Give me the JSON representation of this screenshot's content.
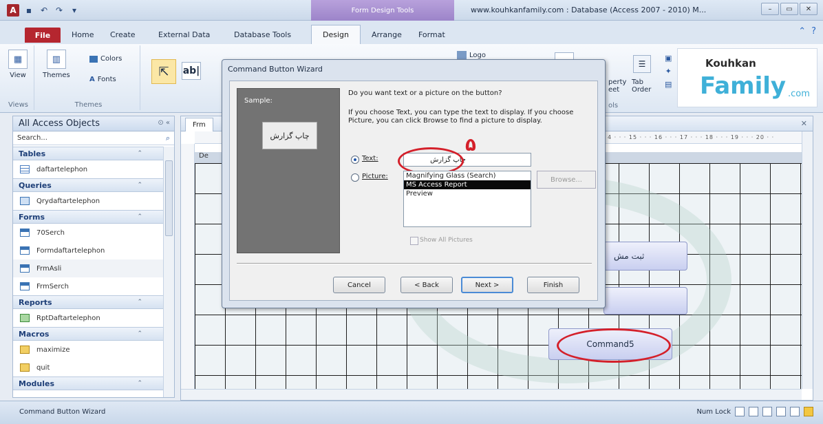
{
  "window": {
    "title": "www.kouhkanfamily.com : Database (Access 2007 - 2010) M...",
    "context_tab_title": "Form Design Tools"
  },
  "tabs": [
    "File",
    "Home",
    "Create",
    "External Data",
    "Database Tools",
    "Design",
    "Arrange",
    "Format"
  ],
  "ribbon": {
    "view_label": "View",
    "views_group": "Views",
    "themes_label": "Themes",
    "themes_group": "Themes",
    "colors_label": "Colors",
    "fonts_label": "Fonts",
    "logo_label": "Logo",
    "property_sheet_label": "perty\neet",
    "tab_order_label": "Tab\nOrder",
    "tools_group": "ols"
  },
  "logo": {
    "top": "Kouhkan",
    "main": "Family",
    "suffix": ".com"
  },
  "nav": {
    "title": "All Access Objects",
    "search_placeholder": "Search...",
    "sections": [
      {
        "label": "Tables",
        "items": [
          "daftartelephon"
        ]
      },
      {
        "label": "Queries",
        "items": [
          "Qrydaftartelephon"
        ]
      },
      {
        "label": "Forms",
        "items": [
          "70Serch",
          "Formdaftartelephon",
          "FrmAsli",
          "FrmSerch"
        ]
      },
      {
        "label": "Reports",
        "items": [
          "RptDaftartelephon"
        ]
      },
      {
        "label": "Macros",
        "items": [
          "maximize",
          "quit"
        ]
      },
      {
        "label": "Modules",
        "items": []
      }
    ]
  },
  "document": {
    "tab_label": "Frm",
    "ruler_text": "4 · · · 15 · · · 16 · · · 17 · · · 18 · · · 19 · · · 20 · ·",
    "section_label": "De",
    "form_button_1": "ثبت مش",
    "form_button_2": "",
    "command_button": "Command5"
  },
  "dialog": {
    "title": "Command Button Wizard",
    "sample_label": "Sample:",
    "sample_button_text": "چاپ گزارش",
    "question": "Do you want text or a picture on the button?",
    "description": "If you choose Text, you can type the text to display.  If you choose Picture, you can click Browse to find a picture to display.",
    "text_option_label": "Text:",
    "text_value": "چاپ گزارش",
    "picture_option_label": "Picture:",
    "picture_list": [
      "Magnifying Glass (Search)",
      "MS Access Report",
      "Preview"
    ],
    "picture_list_selected": 1,
    "browse_label": "Browse...",
    "show_all_label": "Show All Pictures",
    "buttons": {
      "cancel": "Cancel",
      "back": "< Back",
      "next": "Next >",
      "finish": "Finish"
    }
  },
  "annotation": {
    "step_number": "۵"
  },
  "status": {
    "left": "Command Button Wizard",
    "num_lock": "Num Lock"
  }
}
